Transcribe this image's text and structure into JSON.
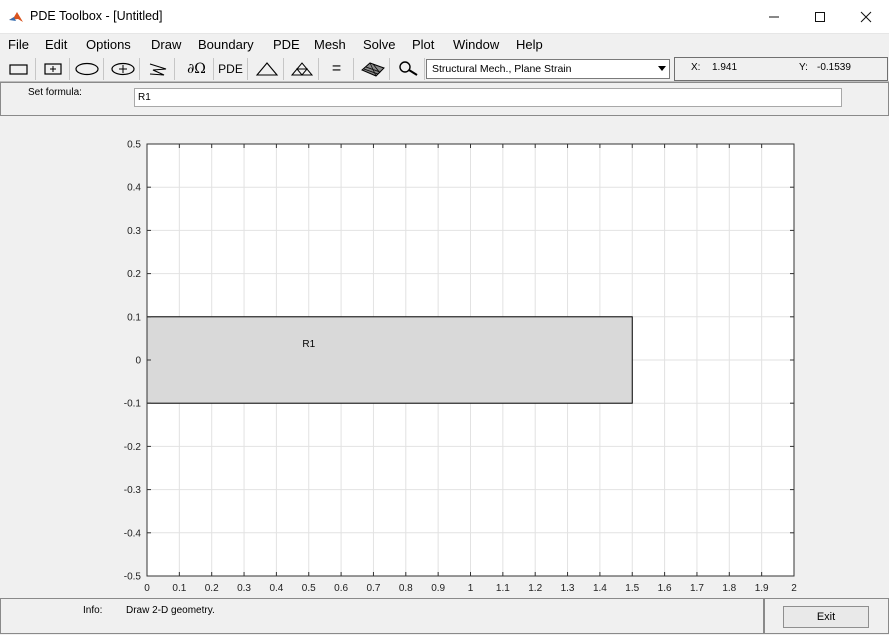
{
  "window": {
    "title": "PDE Toolbox - [Untitled]",
    "app_icon": "matlab-logo-icon"
  },
  "menus": [
    "File",
    "Edit",
    "Options",
    "Draw",
    "Boundary",
    "PDE",
    "Mesh",
    "Solve",
    "Plot",
    "Window",
    "Help"
  ],
  "toolbar": {
    "buttons": [
      {
        "name": "draw-rectangle-button",
        "icon": "rectangle-icon"
      },
      {
        "name": "draw-rectangle-centered-button",
        "icon": "rectangle-centered-icon"
      },
      {
        "name": "draw-ellipse-button",
        "icon": "ellipse-icon"
      },
      {
        "name": "draw-ellipse-centered-button",
        "icon": "ellipse-centered-icon"
      },
      {
        "name": "draw-polygon-button",
        "icon": "polygon-icon"
      },
      {
        "name": "boundary-mode-button",
        "icon": "boundary-icon",
        "label": "∂Ω"
      },
      {
        "name": "pde-specification-button",
        "icon": "pde-icon",
        "label": "PDE"
      },
      {
        "name": "init-mesh-button",
        "icon": "triangle-icon"
      },
      {
        "name": "refine-mesh-button",
        "icon": "refine-triangle-icon"
      },
      {
        "name": "solve-button",
        "icon": "equals-icon",
        "label": "="
      },
      {
        "name": "plot-solution-button",
        "icon": "surface-plot-icon"
      },
      {
        "name": "zoom-button",
        "icon": "zoom-icon"
      }
    ],
    "mode": "Structural Mech., Plane Strain",
    "x_label": "X:",
    "x_value": "1.941",
    "y_label": "Y:",
    "y_value": "-0.1539"
  },
  "formula": {
    "label": "Set formula:",
    "value": "R1"
  },
  "chart_data": {
    "type": "geometry-plot",
    "xlim": [
      0,
      2
    ],
    "ylim": [
      -0.5,
      0.5
    ],
    "xticks": [
      "0",
      "0.1",
      "0.2",
      "0.3",
      "0.4",
      "0.5",
      "0.6",
      "0.7",
      "0.8",
      "0.9",
      "1",
      "1.1",
      "1.2",
      "1.3",
      "1.4",
      "1.5",
      "1.6",
      "1.7",
      "1.8",
      "1.9",
      "2"
    ],
    "yticks": [
      "0.5",
      "0.4",
      "0.3",
      "0.2",
      "0.1",
      "0",
      "-0.1",
      "-0.2",
      "-0.3",
      "-0.4",
      "-0.5"
    ],
    "grid": true,
    "shapes": [
      {
        "label": "R1",
        "type": "rectangle",
        "x0": 0,
        "x1": 1.5,
        "y0": -0.1,
        "y1": 0.1,
        "fill": "#d9d9d9"
      }
    ]
  },
  "status": {
    "info_label": "Info:",
    "info_text": "Draw 2-D geometry.",
    "exit_label": "Exit"
  }
}
